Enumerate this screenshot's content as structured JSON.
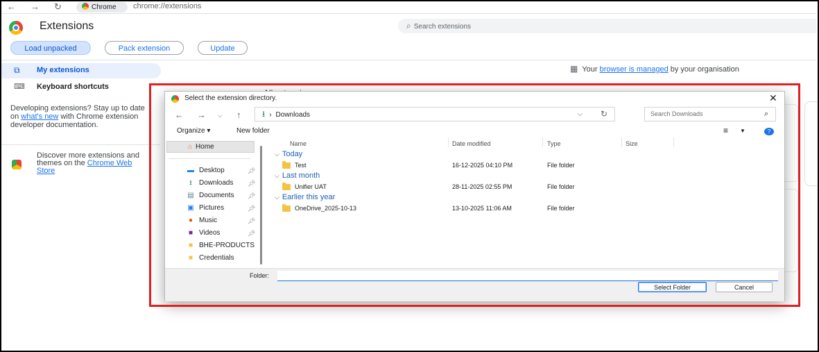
{
  "browser": {
    "tab_chip": "Chrome",
    "url": "chrome://extensions",
    "back_icon": "arrow-left",
    "forward_icon": "arrow-right",
    "reload_icon": "reload"
  },
  "header": {
    "title": "Extensions",
    "search_placeholder": "Search extensions"
  },
  "toolbar": {
    "load_unpacked": "Load unpacked",
    "pack_extension": "Pack extension",
    "update": "Update"
  },
  "sidebar": {
    "my_extensions": "My extensions",
    "keyboard_shortcuts": "Keyboard shortcuts",
    "dev_text_1": "Developing extensions? Stay up to date on ",
    "dev_link": "what's new",
    "dev_text_2": " with Chrome extension developer documentation.",
    "store_text": "Discover more extensions and themes on the ",
    "store_link": "Chrome Web Store"
  },
  "managed": {
    "prefix": "Your ",
    "link": "browser is managed",
    "suffix": " by your organisation"
  },
  "background": {
    "all_extensions": "All extensions"
  },
  "dialog": {
    "title": "Select the extension directory.",
    "address_location": "Downloads",
    "search_placeholder": "Search Downloads",
    "organize": "Organize",
    "new_folder": "New folder",
    "nav_home": "Home",
    "nav_items": [
      {
        "label": "Desktop",
        "icon": "desktop-icon",
        "pinned": true
      },
      {
        "label": "Downloads",
        "icon": "download-icon",
        "pinned": true
      },
      {
        "label": "Documents",
        "icon": "documents-icon",
        "pinned": true
      },
      {
        "label": "Pictures",
        "icon": "pictures-icon",
        "pinned": true
      },
      {
        "label": "Music",
        "icon": "music-icon",
        "pinned": true
      },
      {
        "label": "Videos",
        "icon": "videos-icon",
        "pinned": true
      },
      {
        "label": "BHE-PRODUCTS",
        "icon": "folder-icon",
        "pinned": false
      },
      {
        "label": "Credentials",
        "icon": "folder-icon",
        "pinned": false
      }
    ],
    "columns": {
      "name": "Name",
      "date_modified": "Date modified",
      "type": "Type",
      "size": "Size"
    },
    "groups": [
      {
        "label": "Today",
        "rows": [
          {
            "name": "Test",
            "date": "16-12-2025 04:10 PM",
            "type": "File folder"
          }
        ]
      },
      {
        "label": "Last month",
        "rows": [
          {
            "name": "Unifier UAT",
            "date": "28-11-2025 02:55 PM",
            "type": "File folder"
          }
        ]
      },
      {
        "label": "Earlier this year",
        "rows": [
          {
            "name": "OneDrive_2025-10-13",
            "date": "13-10-2025 11:06 AM",
            "type": "File folder"
          }
        ]
      }
    ],
    "folder_label": "Folder:",
    "folder_value": "",
    "select_folder": "Select Folder",
    "cancel": "Cancel"
  },
  "colors": {
    "accent": "#1a73e8",
    "highlight_border": "#e02020",
    "folder": "#f6c244"
  }
}
